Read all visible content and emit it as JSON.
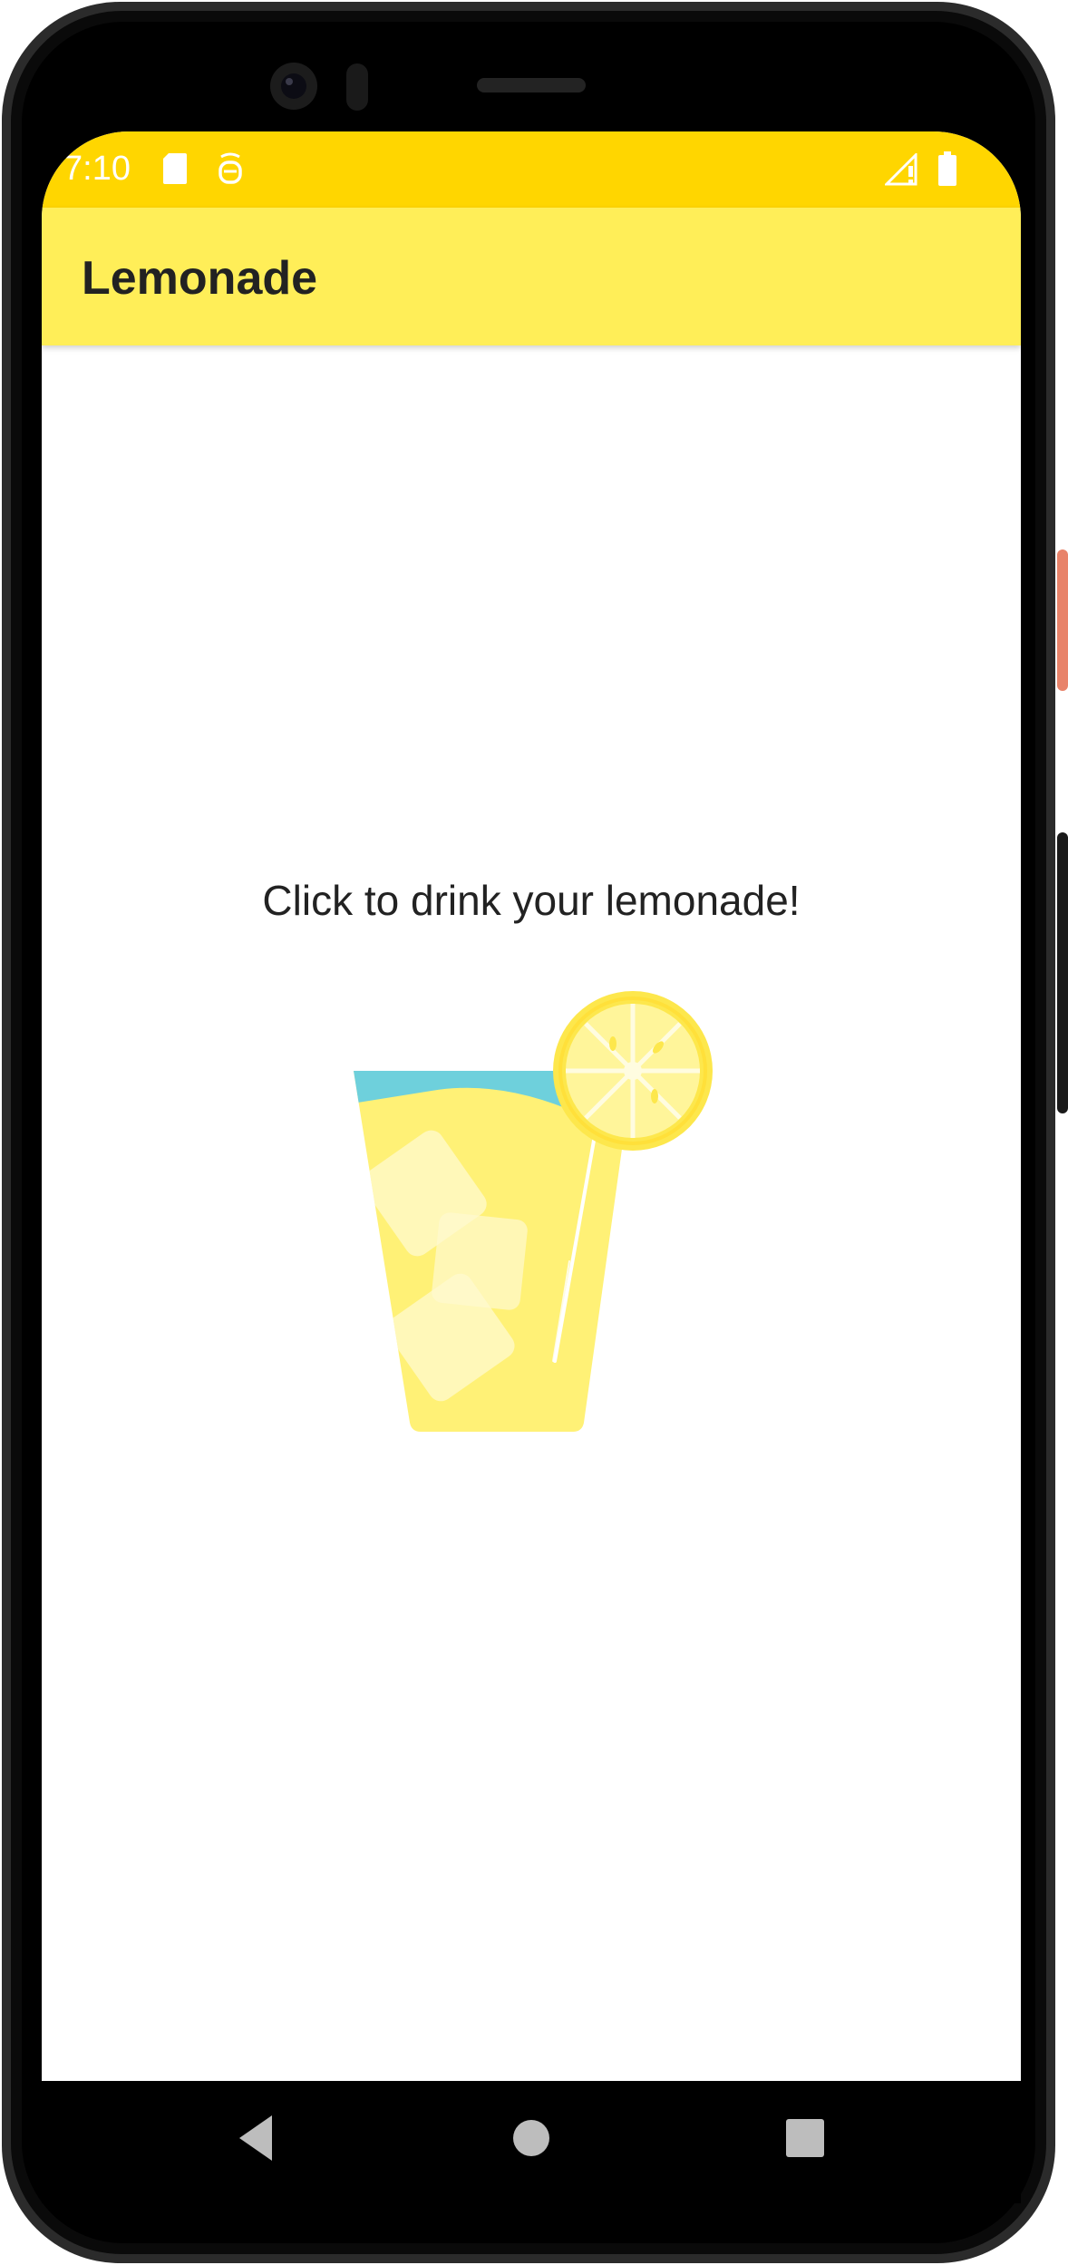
{
  "status_bar": {
    "time": "7:10",
    "background_color": "#FFD600",
    "icons": [
      "sd-card-icon",
      "notification-icon",
      "signal-icon",
      "battery-icon"
    ]
  },
  "app_bar": {
    "title": "Lemonade",
    "background_color": "#FFEE58"
  },
  "main": {
    "instruction": "Click to drink your lemonade!",
    "image": {
      "name": "lemonade-glass",
      "colors": {
        "liquid": "#FFF176",
        "top_liquid": "#6ED0DC",
        "lemon": "#FFEB3B"
      }
    }
  },
  "nav_bar": {
    "buttons": [
      "back-icon",
      "home-icon",
      "recents-icon"
    ]
  }
}
